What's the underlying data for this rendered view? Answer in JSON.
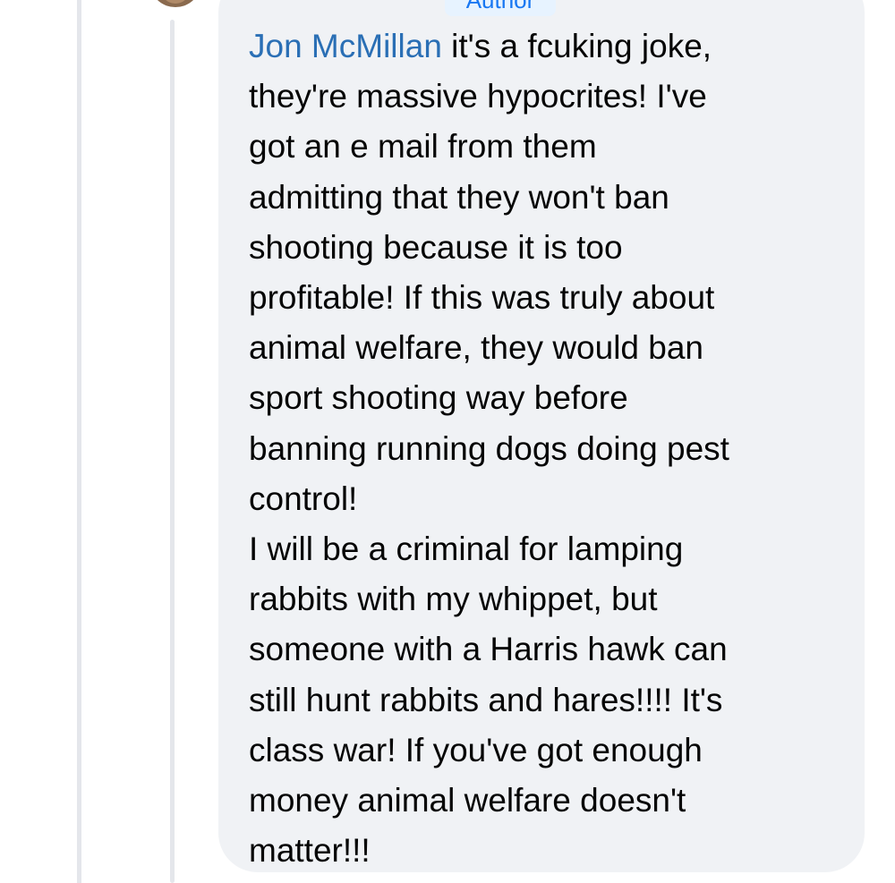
{
  "thread": {
    "author_badge": "Author"
  },
  "comment": {
    "mention": "Jon McMillan",
    "first_line_rest": " it's a fcuking joke,",
    "lines": [
      "they're massive hypocrites! I've",
      "got an e mail from them",
      "admitting that they won't ban",
      "shooting because it is too",
      "profitable! If this was truly about",
      "animal welfare, they would ban",
      "sport shooting way before",
      "banning running dogs doing pest",
      "control!",
      "I will be a criminal for lamping",
      "rabbits with my whippet, but",
      "someone with a Harris hawk can",
      "still hunt rabbits and hares!!!! It's",
      "class war! If you've got enough",
      "money animal welfare doesn't",
      "matter!!!"
    ]
  },
  "colors": {
    "bubble_background": "#f0f2f5",
    "mention": "#2a6fb5",
    "text": "#050505",
    "thread_line": "#e4e6eb",
    "badge_background": "#e7f3ff",
    "badge_text": "#1877f2"
  }
}
